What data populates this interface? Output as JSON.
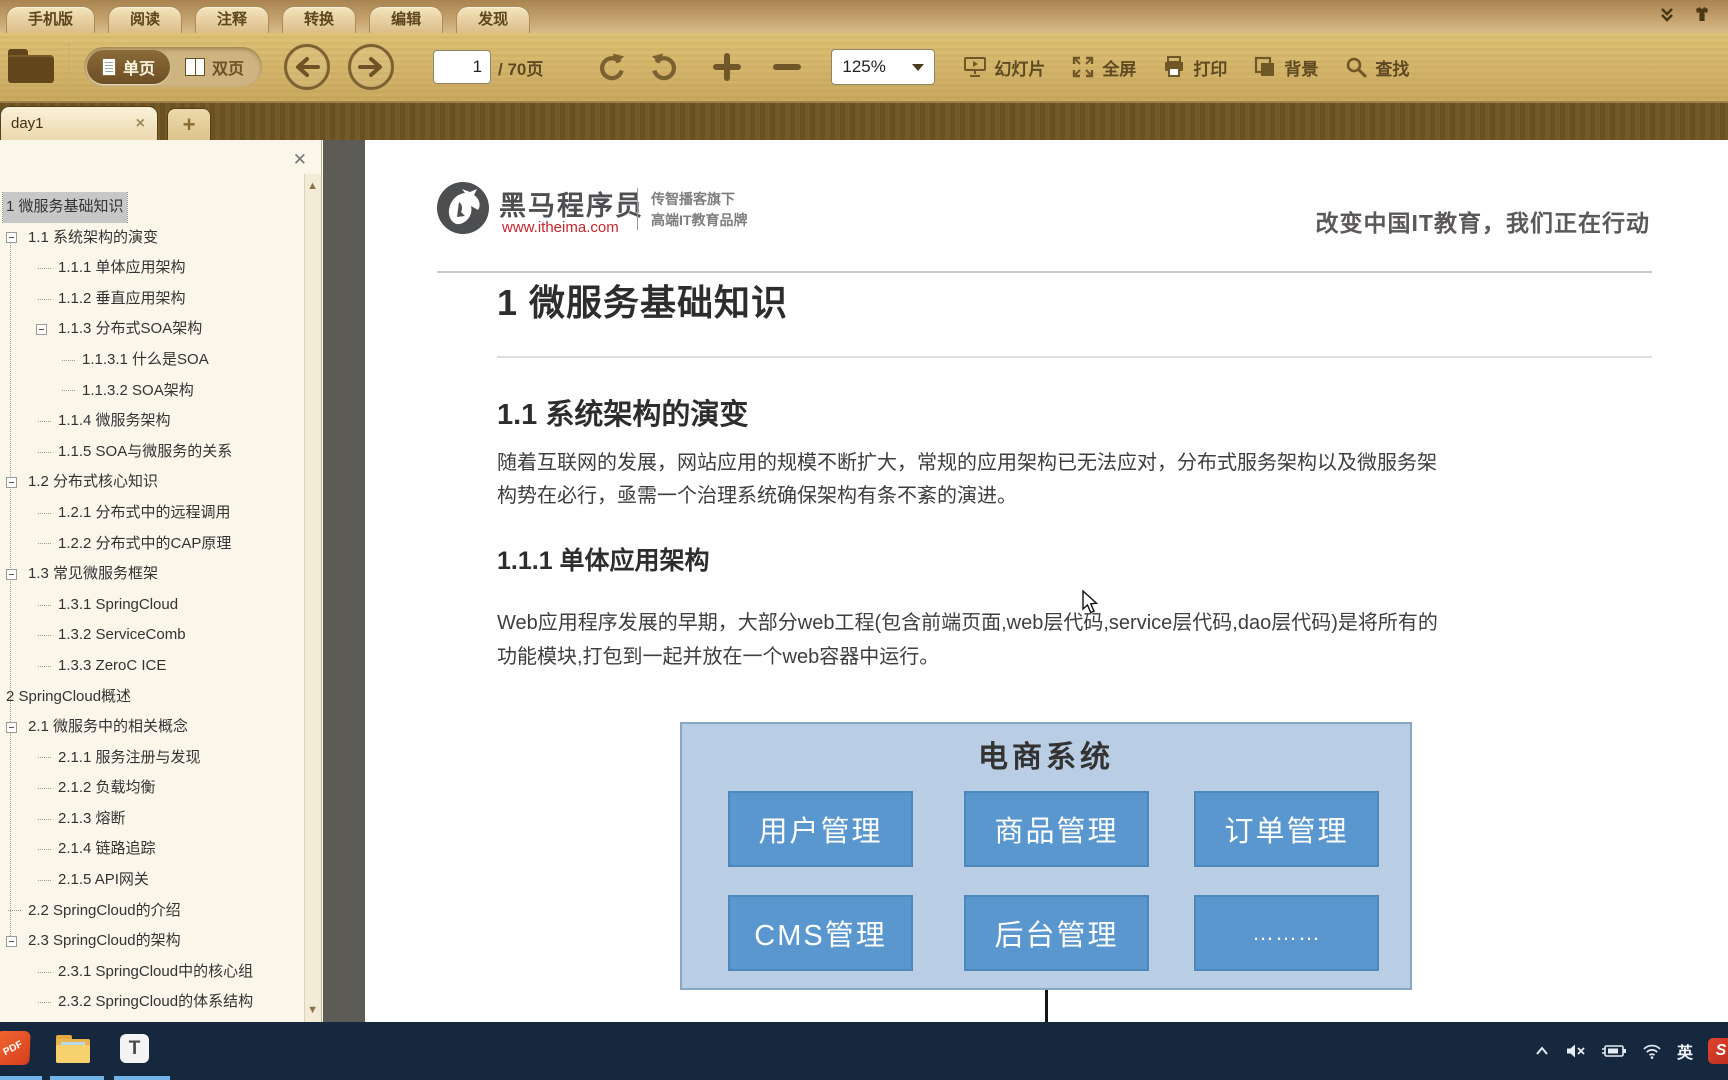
{
  "ribbon": {
    "tabs": [
      "手机版",
      "阅读",
      "注释",
      "转换",
      "编辑",
      "发现"
    ]
  },
  "toolbar": {
    "view_single": "单页",
    "view_double": "双页",
    "page_value": "1",
    "page_total": "/ 70页",
    "zoom_level": "125%",
    "slideshow_label": "幻灯片",
    "fullscreen_label": "全屏",
    "print_label": "打印",
    "background_label": "背景",
    "find_label": "查找"
  },
  "doc_tabs": {
    "active_tab": "day1",
    "close_glyph": "×",
    "new_tab_glyph": "+"
  },
  "sidebar": {
    "items": [
      {
        "label": "1 微服务基础知识",
        "level": 0,
        "expander": false,
        "selected": true
      },
      {
        "label": "1.1 系统架构的演变",
        "level": 1,
        "expander": true
      },
      {
        "label": "1.1.1 单体应用架构",
        "level": 2,
        "expander": false
      },
      {
        "label": "1.1.2 垂直应用架构",
        "level": 2,
        "expander": false
      },
      {
        "label": "1.1.3 分布式SOA架构",
        "level": 2,
        "expander": true
      },
      {
        "label": "1.1.3.1 什么是SOA",
        "level": 3,
        "expander": false
      },
      {
        "label": "1.1.3.2 SOA架构",
        "level": 3,
        "expander": false
      },
      {
        "label": "1.1.4 微服务架构",
        "level": 2,
        "expander": false
      },
      {
        "label": "1.1.5 SOA与微服务的关系",
        "level": 2,
        "expander": false
      },
      {
        "label": "1.2 分布式核心知识",
        "level": 1,
        "expander": true
      },
      {
        "label": "1.2.1 分布式中的远程调用",
        "level": 2,
        "expander": false
      },
      {
        "label": "1.2.2 分布式中的CAP原理",
        "level": 2,
        "expander": false
      },
      {
        "label": "1.3 常见微服务框架",
        "level": 1,
        "expander": true
      },
      {
        "label": "1.3.1 SpringCloud",
        "level": 2,
        "expander": false
      },
      {
        "label": "1.3.2 ServiceComb",
        "level": 2,
        "expander": false
      },
      {
        "label": "1.3.3 ZeroC ICE",
        "level": 2,
        "expander": false
      },
      {
        "label": "2 SpringCloud概述",
        "level": 0,
        "expander": false
      },
      {
        "label": "2.1 微服务中的相关概念",
        "level": 1,
        "expander": true
      },
      {
        "label": "2.1.1 服务注册与发现",
        "level": 2,
        "expander": false
      },
      {
        "label": "2.1.2 负载均衡",
        "level": 2,
        "expander": false
      },
      {
        "label": "2.1.3 熔断",
        "level": 2,
        "expander": false
      },
      {
        "label": "2.1.4 链路追踪",
        "level": 2,
        "expander": false
      },
      {
        "label": "2.1.5 API网关",
        "level": 2,
        "expander": false
      },
      {
        "label": "2.2 SpringCloud的介绍",
        "level": 1,
        "expander": false
      },
      {
        "label": "2.3 SpringCloud的架构",
        "level": 1,
        "expander": true
      },
      {
        "label": "2.3.1 SpringCloud中的核心组",
        "level": 2,
        "expander": false
      },
      {
        "label": "2.3.2 SpringCloud的体系结构",
        "level": 2,
        "expander": false
      }
    ]
  },
  "page": {
    "header": {
      "brand": "黑马程序员",
      "brand_url": "www.itheima.com",
      "tagline_line1": "传智播客旗下",
      "tagline_line2": "高端IT教育品牌",
      "slogan": "改变中国IT教育，我们正在行动"
    },
    "h1": "1 微服务基础知识",
    "h2": "1.1 系统架构的演变",
    "p1": "随着互联网的发展，网站应用的规模不断扩大，常规的应用架构已无法应对，分布式服务架构以及微服务架构势在必行，亟需一个治理系统确保架构有条不紊的演进。",
    "h3": "1.1.1 单体应用架构",
    "p2": "Web应用程序发展的早期，大部分web工程(包含前端页面,web层代码,service层代码,dao层代码)是将所有的功能模块,打包到一起并放在一个web容器中运行。",
    "diagram": {
      "title": "电商系统",
      "row1": [
        "用户管理",
        "商品管理",
        "订单管理"
      ],
      "row2": [
        "CMS管理",
        "后台管理",
        "………"
      ]
    }
  },
  "taskbar": {
    "ime": "英"
  },
  "colors": {
    "ribbon_gold": "#c3a06c",
    "toolbar_tan": "#e5d3a3",
    "tabbar_brown": "#6e5426",
    "diagram_outer": "#b9cee5",
    "diagram_inner": "#5b97cf",
    "taskbar_navy": "#16283d",
    "underline_blue": "#6fb3e8",
    "brand_red": "#c6262c"
  }
}
